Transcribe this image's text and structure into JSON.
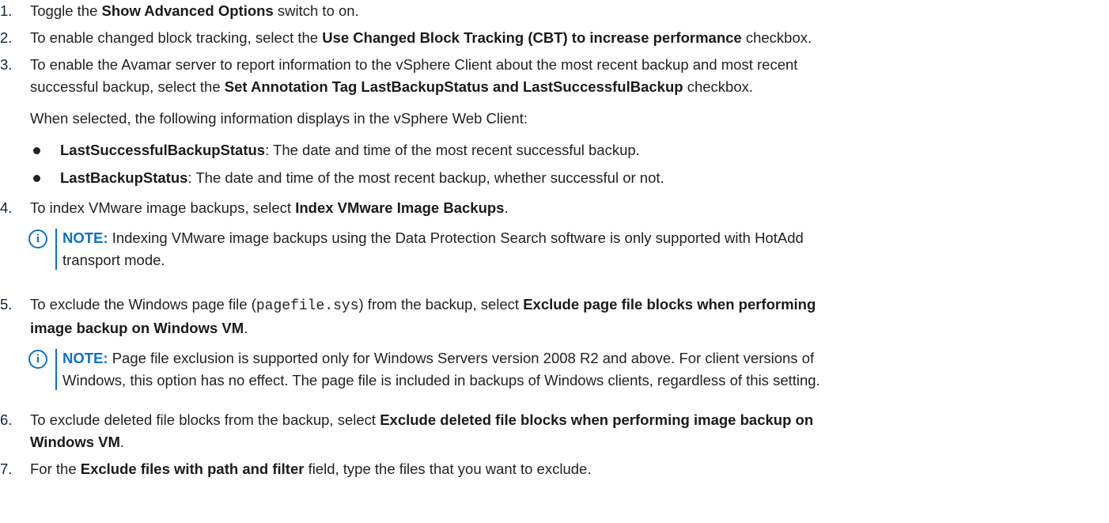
{
  "steps": [
    {
      "num": "1.",
      "pre": "Toggle the ",
      "bold": "Show Advanced Options",
      "post": " switch to on."
    },
    {
      "num": "2.",
      "pre": "To enable changed block tracking, select the ",
      "bold": "Use Changed Block Tracking (CBT) to increase performance",
      "post": " checkbox."
    },
    {
      "num": "3.",
      "line1": "To enable the Avamar server to report information to the vSphere Client about the most recent backup and most recent",
      "pre": "successful backup, select the ",
      "bold": "Set Annotation Tag LastBackupStatus and LastSuccessfulBackup",
      "post": " checkbox.",
      "para": "When selected, the following information displays in the vSphere Web Client:",
      "bullets": [
        {
          "bold": "LastSuccessfulBackupStatus",
          "text": ": The date and time of the most recent successful backup."
        },
        {
          "bold": "LastBackupStatus",
          "text": ": The date and time of the most recent backup, whether successful or not."
        }
      ]
    },
    {
      "num": "4.",
      "pre": "To index VMware image backups, select ",
      "bold": "Index VMware Image Backups",
      "post": ".",
      "note_label": "NOTE:",
      "note_line1": " Indexing VMware image backups using the Data Protection Search software is only supported with HotAdd",
      "note_line2": "transport mode."
    },
    {
      "num": "5.",
      "pre": "To exclude the Windows page file (",
      "mono": "pagefile.sys",
      "mid": ") from the backup, select ",
      "bold1": "Exclude page file blocks when performing",
      "bold2": "image backup on Windows VM",
      "post": ".",
      "note_label": "NOTE:",
      "note_line1": " Page file exclusion is supported only for Windows Servers version 2008 R2 and above. For client versions of",
      "note_line2": "Windows, this option has no effect. The page file is included in backups of Windows clients, regardless of this setting."
    },
    {
      "num": "6.",
      "pre": "To exclude deleted file blocks from the backup, select ",
      "bold1": "Exclude deleted file blocks when performing image backup on",
      "bold2": "Windows VM",
      "post": "."
    },
    {
      "num": "7.",
      "pre": "For the ",
      "bold": "Exclude files with path and filter",
      "post": " field, type the files that you want to exclude."
    }
  ],
  "colors": {
    "accent": "#0b72c8",
    "number": "#0b2447",
    "text": "#222222"
  },
  "icons": {
    "note": "info-circle-icon"
  }
}
